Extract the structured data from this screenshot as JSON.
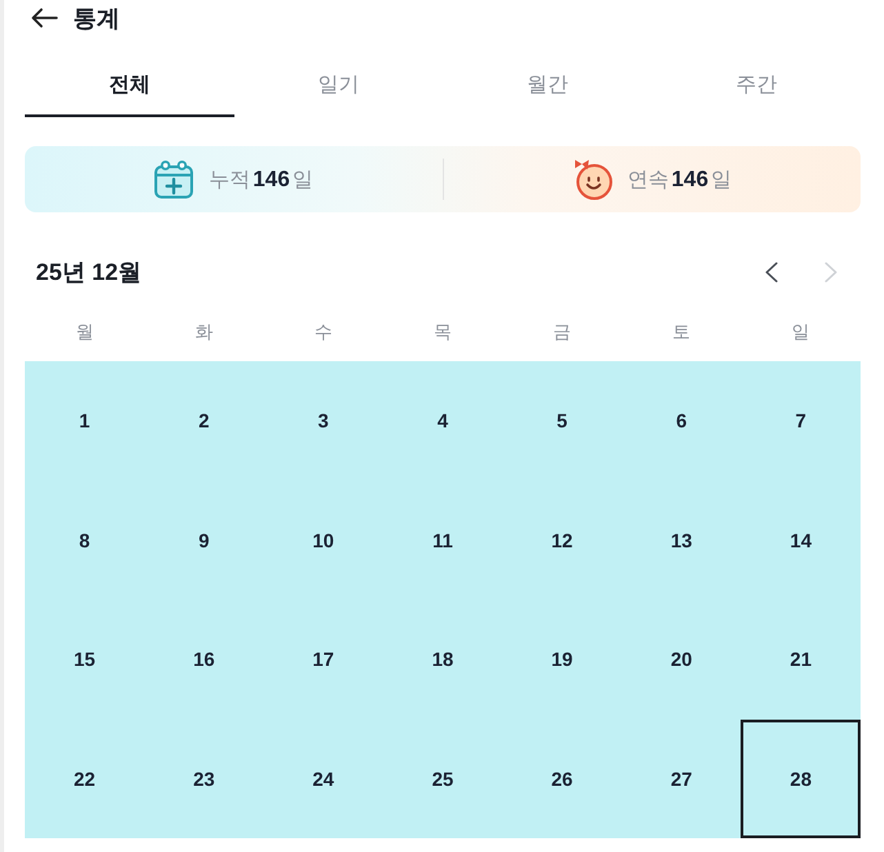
{
  "header": {
    "title": "통계"
  },
  "tabs": [
    {
      "label": "전체",
      "selected": true
    },
    {
      "label": "일기",
      "selected": false
    },
    {
      "label": "월간",
      "selected": false
    },
    {
      "label": "주간",
      "selected": false
    }
  ],
  "stats": [
    {
      "kind": "total",
      "text": "누적**146**일"
    },
    {
      "kind": "streak",
      "text": "연속**146**일"
    }
  ],
  "calendar": {
    "month": "25년 12월",
    "prev": {
      "disabled": false
    },
    "next": {
      "disabled": true
    },
    "weekdays": [
      "월",
      "화",
      "수",
      "목",
      "금",
      "토",
      "일"
    ],
    "days": [
      {
        "label": "1",
        "marked": true,
        "selected": false
      },
      {
        "label": "2",
        "marked": true,
        "selected": false
      },
      {
        "label": "3",
        "marked": true,
        "selected": false
      },
      {
        "label": "4",
        "marked": true,
        "selected": false
      },
      {
        "label": "5",
        "marked": true,
        "selected": false
      },
      {
        "label": "6",
        "marked": true,
        "selected": false
      },
      {
        "label": "7",
        "marked": true,
        "selected": false
      },
      {
        "label": "8",
        "marked": true,
        "selected": false
      },
      {
        "label": "9",
        "marked": true,
        "selected": false
      },
      {
        "label": "10",
        "marked": true,
        "selected": false
      },
      {
        "label": "11",
        "marked": true,
        "selected": false
      },
      {
        "label": "12",
        "marked": true,
        "selected": false
      },
      {
        "label": "13",
        "marked": true,
        "selected": false
      },
      {
        "label": "14",
        "marked": true,
        "selected": false
      },
      {
        "label": "15",
        "marked": true,
        "selected": false
      },
      {
        "label": "16",
        "marked": true,
        "selected": false
      },
      {
        "label": "17",
        "marked": true,
        "selected": false
      },
      {
        "label": "18",
        "marked": true,
        "selected": false
      },
      {
        "label": "19",
        "marked": true,
        "selected": false
      },
      {
        "label": "20",
        "marked": true,
        "selected": false
      },
      {
        "label": "21",
        "marked": true,
        "selected": false
      },
      {
        "label": "22",
        "marked": true,
        "selected": false
      },
      {
        "label": "23",
        "marked": true,
        "selected": false
      },
      {
        "label": "24",
        "marked": true,
        "selected": false
      },
      {
        "label": "25",
        "marked": true,
        "selected": false
      },
      {
        "label": "26",
        "marked": true,
        "selected": false
      },
      {
        "label": "27",
        "marked": true,
        "selected": false
      },
      {
        "label": "28",
        "marked": true,
        "selected": true
      }
    ]
  }
}
